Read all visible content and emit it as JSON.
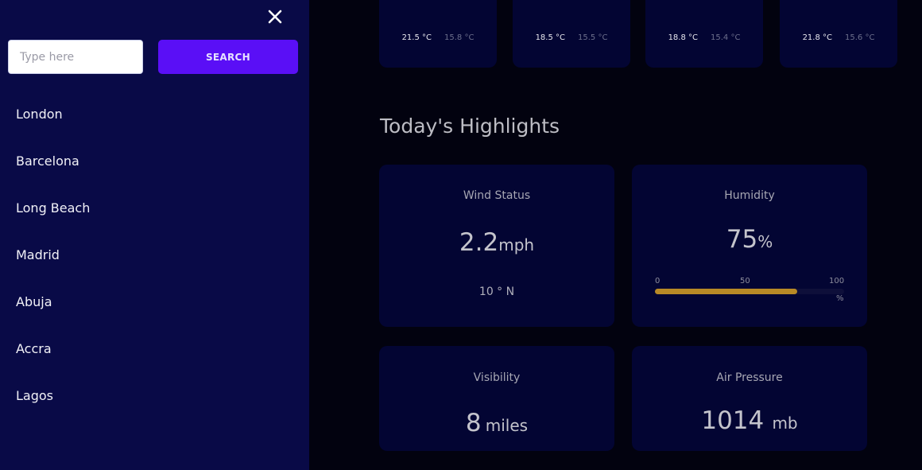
{
  "sidebar": {
    "search": {
      "placeholder": "Type here",
      "value": "",
      "button_label": "SEARCH"
    },
    "cities": [
      "London",
      "Barcelona",
      "Long Beach",
      "Madrid",
      "Abuja",
      "Accra",
      "Lagos"
    ]
  },
  "forecast": [
    {
      "max": "21.5 °C",
      "min": "15.8 °C"
    },
    {
      "max": "18.5 °C",
      "min": "15.5 °C"
    },
    {
      "max": "18.8 °C",
      "min": "15.4 °C"
    },
    {
      "max": "21.8 °C",
      "min": "15.6 °C"
    }
  ],
  "highlights": {
    "title": "Today's Highlights",
    "wind": {
      "label": "Wind Status",
      "value": "2.2",
      "unit": "mph",
      "direction": "10 °  N"
    },
    "humidity": {
      "label": "Humidity",
      "value": "75",
      "unit": "%",
      "percent": 75,
      "scale": {
        "min": "0",
        "mid": "50",
        "max": "100",
        "unit": "%"
      }
    },
    "visibility": {
      "label": "Visibility",
      "value": "8",
      "unit": "miles"
    },
    "air_pressure": {
      "label": "Air Pressure",
      "value": "1014",
      "unit": "mb"
    }
  },
  "icons": {
    "close": "close-icon"
  },
  "colors": {
    "sidebar_bg": "#090a47",
    "page_bg": "#02020f",
    "card_bg": "#030533",
    "accent": "#5a0ff6",
    "humidity_bar": "#b88a26"
  }
}
